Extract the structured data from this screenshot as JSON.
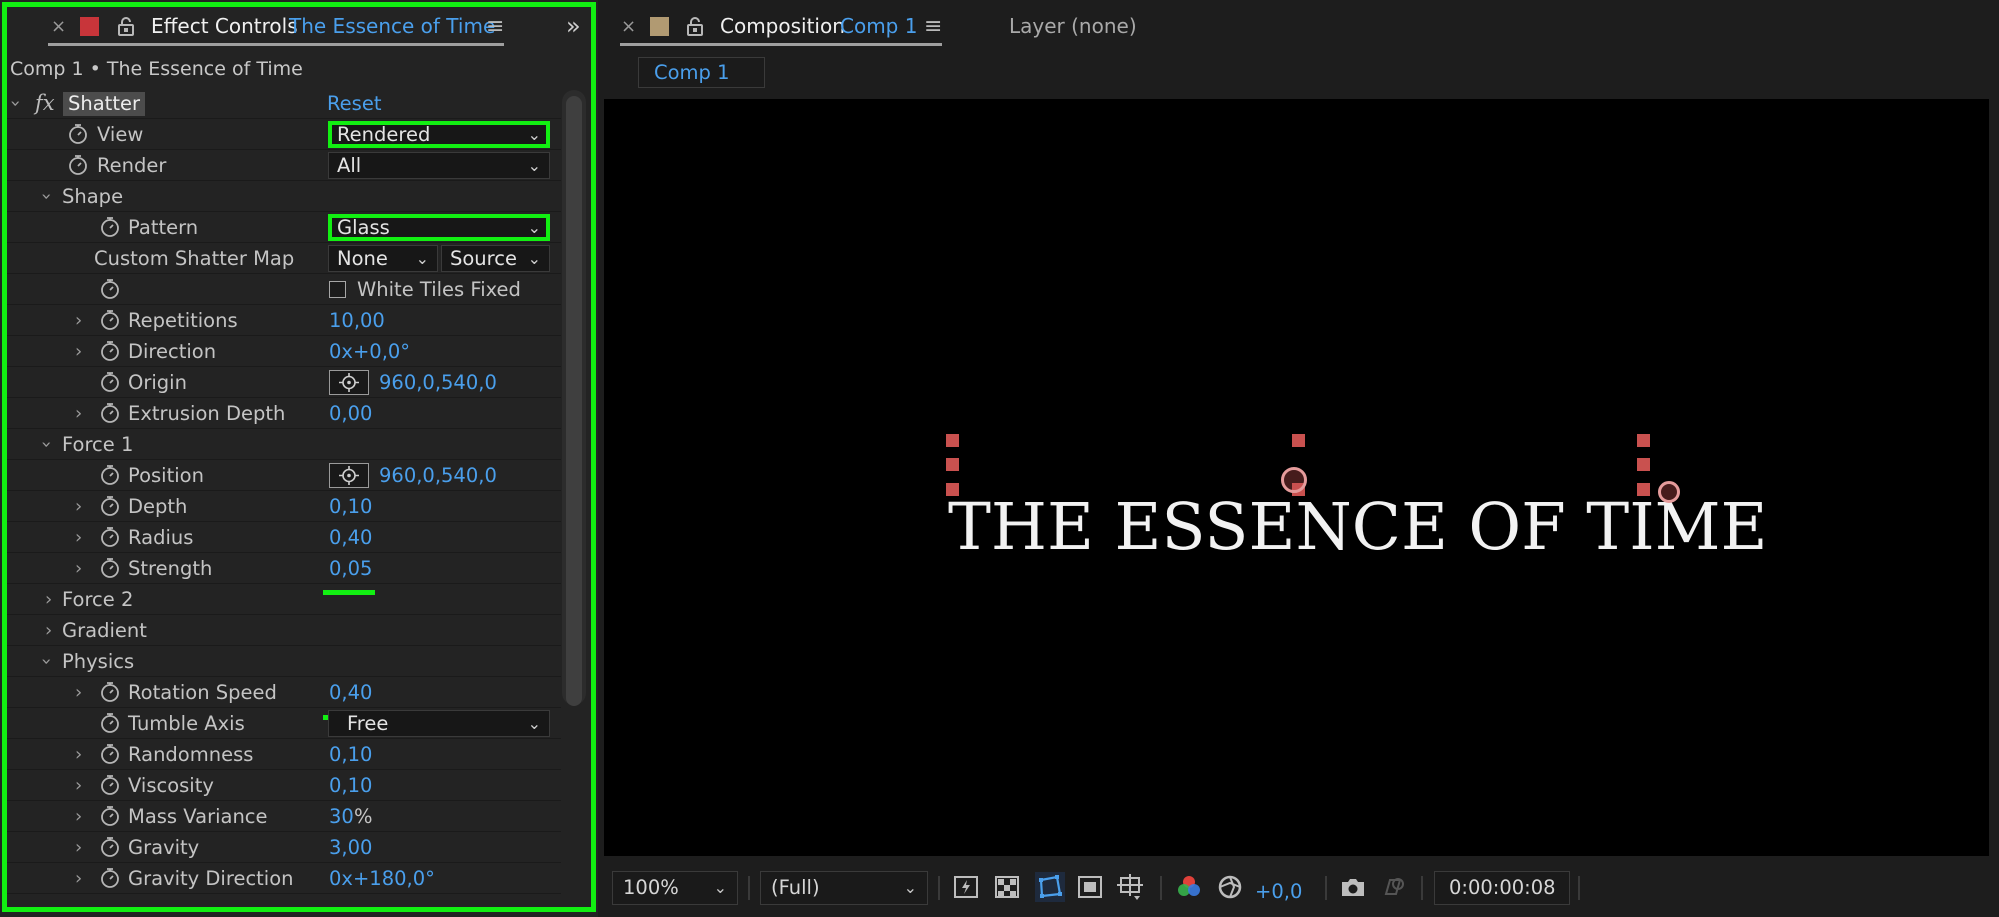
{
  "left_panel": {
    "tab_close": "×",
    "tab_title": "Effect Controls",
    "tab_layer": "The Essence of Time",
    "menu": "≡",
    "collapse": "»",
    "header": "Comp 1 • The Essence of Time"
  },
  "effect": {
    "fx": "fx",
    "name": "Shatter",
    "reset": "Reset",
    "view_label": "View",
    "view_value": "Rendered",
    "render_label": "Render",
    "render_value": "All",
    "shape_label": "Shape",
    "pattern_label": "Pattern",
    "pattern_value": "Glass",
    "custom_map_label": "Custom Shatter Map",
    "custom_map_value": "None",
    "custom_map_source": "Source",
    "white_tiles_label": "White Tiles Fixed",
    "repetitions_label": "Repetitions",
    "repetitions_value": "10,00",
    "direction_label": "Direction",
    "direction_value": "0x+0,0°",
    "origin_label": "Origin",
    "origin_value": "960,0,540,0",
    "extrusion_label": "Extrusion Depth",
    "extrusion_value": "0,00",
    "force1_label": "Force 1",
    "position_label": "Position",
    "position_value": "960,0,540,0",
    "depth_label": "Depth",
    "depth_value": "0,10",
    "radius_label": "Radius",
    "radius_value": "0,40",
    "strength_label": "Strength",
    "strength_value": "0,05",
    "force2_label": "Force 2",
    "gradient_label": "Gradient",
    "physics_label": "Physics",
    "rotation_label": "Rotation Speed",
    "rotation_value": "0,40",
    "tumble_label": "Tumble Axis",
    "tumble_value": "Free",
    "randomness_label": "Randomness",
    "randomness_value": "0,10",
    "viscosity_label": "Viscosity",
    "viscosity_value": "0,10",
    "mass_label": "Mass Variance",
    "mass_value": "30",
    "mass_unit": "%",
    "gravity_label": "Gravity",
    "gravity_value": "3,00",
    "gravity_dir_label": "Gravity Direction",
    "gravity_dir_value": "0x+180,0°"
  },
  "right_panel": {
    "tab_close": "×",
    "tab_title": "Composition",
    "tab_comp": "Comp 1",
    "menu": "≡",
    "layer_tab": "Layer (none)",
    "comp_button": "Comp 1",
    "viewer_text": "THE ESSENCE OF TIME"
  },
  "bottom_bar": {
    "zoom": "100%",
    "resolution": "(Full)",
    "exposure": "+0,0",
    "timecode": "0:00:00:08"
  },
  "colors": {
    "highlight": "#12ef12",
    "accent": "#4a9fec",
    "handle": "#c9514f"
  }
}
